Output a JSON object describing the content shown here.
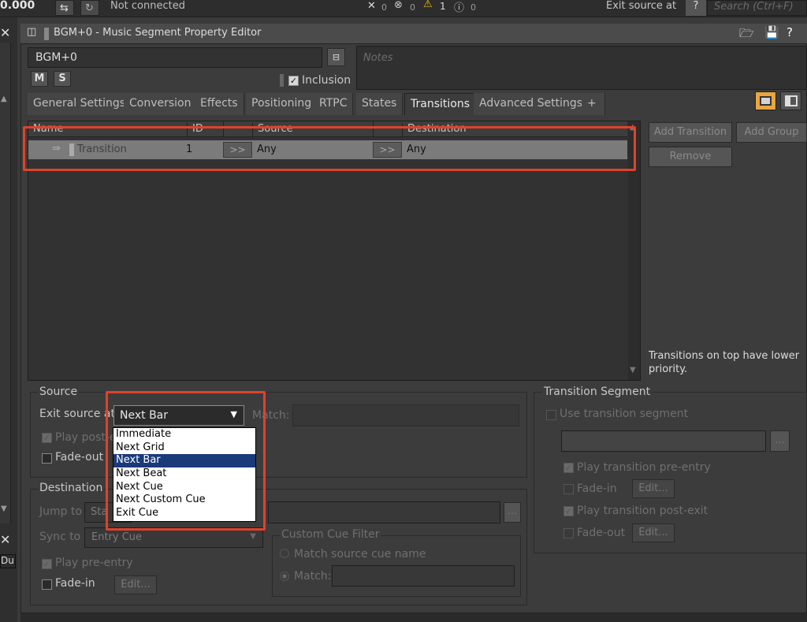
{
  "topbar": {
    "fps": "0.000",
    "connection": "Not connected",
    "counts": {
      "errors": "0",
      "blocked": "0",
      "warnings": "1",
      "info": "0"
    },
    "exit_source_label": "Exit source at",
    "help": "?",
    "search_placeholder": "Search (Ctrl+F)"
  },
  "left": {
    "du": "Du"
  },
  "editor": {
    "title": "BGM+0 - Music Segment Property Editor",
    "name_value": "BGM+0",
    "m_label": "M",
    "s_label": "S",
    "inclusion_label": "Inclusion",
    "notes_placeholder": "Notes"
  },
  "tabs": [
    {
      "label": "General Settings"
    },
    {
      "label": "Conversion"
    },
    {
      "label": "Effects"
    },
    {
      "label": "Positioning"
    },
    {
      "label": "RTPC"
    },
    {
      "label": "States"
    },
    {
      "label": "Transitions"
    },
    {
      "label": "Advanced Settings"
    },
    {
      "label": "+"
    }
  ],
  "grid": {
    "columns": [
      "Name",
      "ID",
      "Source",
      "Destination"
    ],
    "row": {
      "name": "Transition",
      "id": "1",
      "source": "Any",
      "destination": "Any",
      "arrow": ">>"
    }
  },
  "side": {
    "add_transition": "Add Transition",
    "add_group": "Add Group",
    "remove": "Remove",
    "note": "Transitions on top have lower priority."
  },
  "source": {
    "title": "Source",
    "exit_label": "Exit source at",
    "exit_value": "Next Bar",
    "match_label": "Match:",
    "play_post_exit": "Play post-e",
    "fade_out": "Fade-out",
    "options": [
      "Immediate",
      "Next Grid",
      "Next Bar",
      "Next Beat",
      "Next Cue",
      "Next Custom Cue",
      "Exit Cue"
    ]
  },
  "destination": {
    "title": "Destination",
    "jump_label": "Jump to",
    "jump_value": "Sta",
    "sync_label": "Sync to",
    "sync_value": "Entry Cue",
    "play_pre_entry": "Play pre-entry",
    "fade_in": "Fade-in",
    "edit": "Edit...",
    "filter_title": "Custom Cue Filter",
    "match_source": "Match source cue name",
    "match": "Match:"
  },
  "transition_segment": {
    "title": "Transition Segment",
    "use": "Use transition segment",
    "play_pre_entry": "Play transition pre-entry",
    "fade_in": "Fade-in",
    "play_post_exit": "Play transition post-exit",
    "fade_out": "Fade-out",
    "edit": "Edit...",
    "browse": "..."
  },
  "colors": {
    "highlight": "#e0422a",
    "selection": "#1a3a7a"
  }
}
